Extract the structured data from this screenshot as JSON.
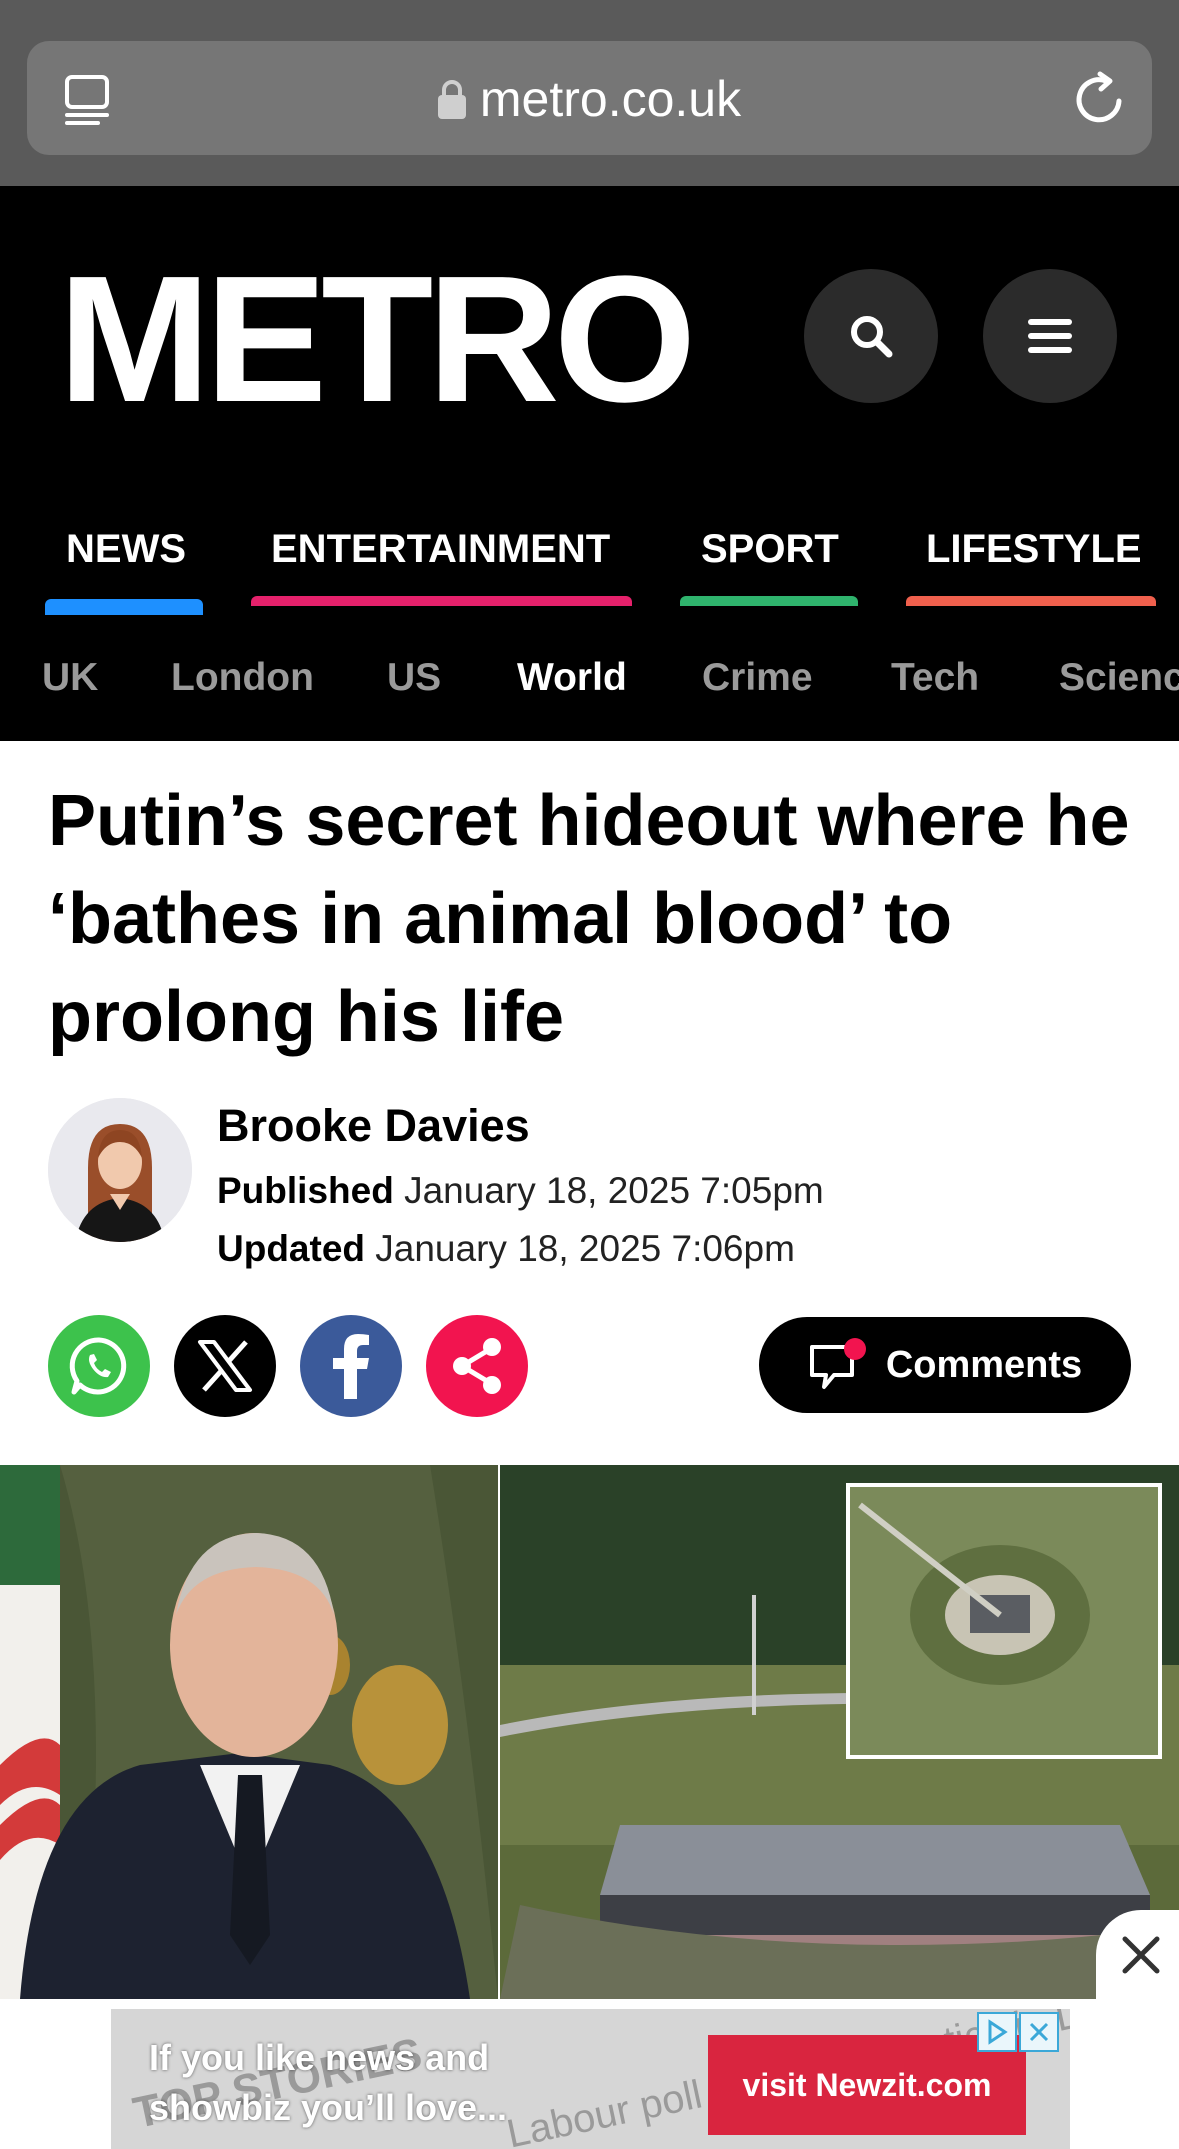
{
  "browser": {
    "url": "metro.co.uk"
  },
  "site": {
    "logo_text": "METRO"
  },
  "sections": [
    {
      "label": "NEWS",
      "color": "#1e90ff"
    },
    {
      "label": "ENTERTAINMENT",
      "color": "#e5216b"
    },
    {
      "label": "SPORT",
      "color": "#2fb36d"
    },
    {
      "label": "LIFESTYLE",
      "color": "#f0604d"
    }
  ],
  "subnav": [
    "UK",
    "London",
    "US",
    "World",
    "Crime",
    "Tech",
    "Scienc"
  ],
  "subnav_active": "World",
  "article": {
    "headline": "Putin’s secret hideout where he ‘bathes in animal blood’ to prolong his life",
    "author": "Brooke Davies",
    "published_label": "Published",
    "published_value": "January 18, 2025 7:05pm",
    "updated_label": "Updated",
    "updated_value": "January 18, 2025 7:06pm",
    "comments_label": "Comments"
  },
  "share_buttons": [
    {
      "name": "whatsapp",
      "color": "#3dc24c"
    },
    {
      "name": "x",
      "color": "#000000"
    },
    {
      "name": "facebook",
      "color": "#3b5a9a"
    },
    {
      "name": "share",
      "color": "#f2144f"
    }
  ],
  "ad": {
    "text_line1": "If you like news and",
    "text_line2": "showbiz  you’ll love...",
    "cta": "visit Newzit.com",
    "bg_words_1": "TOP STORIES",
    "bg_words_2": "Labour poll p... voting tactics in L..."
  }
}
